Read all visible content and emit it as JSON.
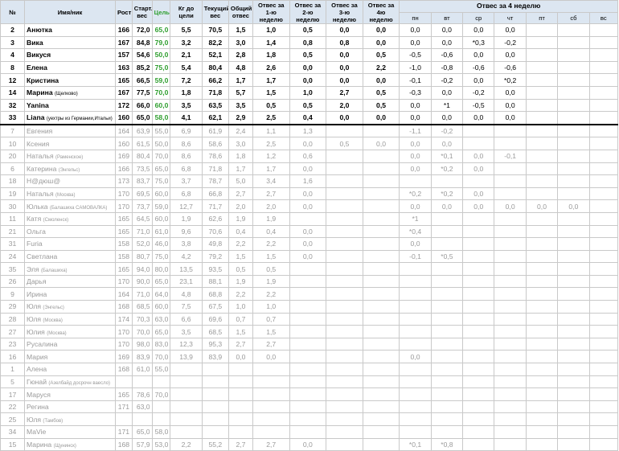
{
  "headers": {
    "num": "№",
    "name": "Имя/ник",
    "height": "Рост",
    "start_weight": "Старт. вес",
    "target": "Цель",
    "to_target": "Кг до цели",
    "current_weight": "Текущий вес",
    "total_loss": "Общий отвес",
    "week1": "Отвес за 1-ю неделю",
    "week2": "Отвес за 2-ю неделю",
    "week3": "Отвес за 3-ю неделю",
    "week4": "Отвес за 4ю неделю",
    "week4_days": "Отвес за 4 неделю",
    "days": [
      "пн",
      "вт",
      "ср",
      "чт",
      "пт",
      "сб",
      "вс"
    ]
  },
  "active_rows": [
    {
      "num": "2",
      "name": "Анютка",
      "note": "",
      "height": "166",
      "start": "72,0",
      "target": "65,0",
      "left": "5,5",
      "current": "70,5",
      "total": "1,5",
      "w1": "1,0",
      "w2": "0,5",
      "w3": "0,0",
      "w4": "0,0",
      "d": [
        "0,0",
        "0,0",
        "0,0",
        "0,0",
        "",
        "",
        ""
      ]
    },
    {
      "num": "3",
      "name": "Вика",
      "note": "",
      "height": "167",
      "start": "84,8",
      "target": "79,0",
      "left": "3,2",
      "current": "82,2",
      "total": "3,0",
      "w1": "1,4",
      "w2": "0,8",
      "w3": "0,8",
      "w4": "0,0",
      "d": [
        "0,0",
        "0,0",
        "*0,3",
        "-0,2",
        "",
        "",
        ""
      ]
    },
    {
      "num": "4",
      "name": "Викуся",
      "note": "",
      "height": "157",
      "start": "54,6",
      "target": "50,0",
      "left": "2,1",
      "current": "52,1",
      "total": "2,8",
      "w1": "1,8",
      "w2": "0,5",
      "w3": "0,0",
      "w4": "0,5",
      "d": [
        "-0,5",
        "-0,6",
        "0,0",
        "0,0",
        "",
        "",
        ""
      ]
    },
    {
      "num": "8",
      "name": "Елена",
      "note": "",
      "height": "163",
      "start": "85,2",
      "target": "75,0",
      "left": "5,4",
      "current": "80,4",
      "total": "4,8",
      "w1": "2,6",
      "w2": "0,0",
      "w3": "0,0",
      "w4": "2,2",
      "d": [
        "-1,0",
        "-0,8",
        "-0,6",
        "-0,6",
        "",
        "",
        ""
      ]
    },
    {
      "num": "12",
      "name": "Кристина",
      "note": "",
      "height": "165",
      "start": "66,5",
      "target": "59,0",
      "left": "7,2",
      "current": "66,2",
      "total": "1,7",
      "w1": "1,7",
      "w2": "0,0",
      "w3": "0,0",
      "w4": "0,0",
      "d": [
        "-0,1",
        "-0,2",
        "0,0",
        "*0,2",
        "",
        "",
        ""
      ]
    },
    {
      "num": "14",
      "name": "Марина",
      "note": "(Щелково)",
      "height": "167",
      "start": "77,5",
      "target": "70,0",
      "left": "1,8",
      "current": "71,8",
      "total": "5,7",
      "w1": "1,5",
      "w2": "1,0",
      "w3": "2,7",
      "w4": "0,5",
      "d": [
        "-0,3",
        "0,0",
        "-0,2",
        "0,0",
        "",
        "",
        ""
      ]
    },
    {
      "num": "32",
      "name": "Yanina",
      "note": "",
      "height": "172",
      "start": "66,0",
      "target": "60,0",
      "left": "3,5",
      "current": "63,5",
      "total": "3,5",
      "w1": "0,5",
      "w2": "0,5",
      "w3": "2,0",
      "w4": "0,5",
      "d": [
        "0,0",
        "*1",
        "-0,5",
        "0,0",
        "",
        "",
        ""
      ]
    },
    {
      "num": "33",
      "name": "Liana",
      "note": "(уехтры из Германии,Итальи)",
      "height": "160",
      "start": "65,0",
      "target": "58,0",
      "left": "4,1",
      "current": "62,1",
      "total": "2,9",
      "w1": "2,5",
      "w2": "0,4",
      "w3": "0,0",
      "w4": "0,0",
      "d": [
        "0,0",
        "0,0",
        "0,0",
        "0,0",
        "",
        "",
        ""
      ]
    }
  ],
  "inactive_rows": [
    {
      "num": "7",
      "name": "Евгения",
      "note": "",
      "height": "164",
      "start": "63,9",
      "target": "55,0",
      "left": "6,9",
      "current": "61,9",
      "total": "2,4",
      "w1": "1,1",
      "w2": "1,3",
      "w3": "",
      "w4": "",
      "d": [
        "-1,1",
        "-0,2",
        "",
        "",
        "",
        "",
        ""
      ]
    },
    {
      "num": "10",
      "name": "Ксения",
      "note": "",
      "height": "160",
      "start": "61,5",
      "target": "50,0",
      "left": "8,6",
      "current": "58,6",
      "total": "3,0",
      "w1": "2,5",
      "w2": "0,0",
      "w3": "0,5",
      "w4": "0,0",
      "d": [
        "0,0",
        "0,0",
        "",
        "",
        "",
        "",
        ""
      ]
    },
    {
      "num": "20",
      "name": "Наталья",
      "note": "(Раменское)",
      "height": "169",
      "start": "80,4",
      "target": "70,0",
      "left": "8,6",
      "current": "78,6",
      "total": "1,8",
      "w1": "1,2",
      "w2": "0,6",
      "w3": "",
      "w4": "",
      "d": [
        "0,0",
        "*0,1",
        "0,0",
        "-0,1",
        "",
        "",
        ""
      ]
    },
    {
      "num": "6",
      "name": "Катерина",
      "note": "(Энгельс)",
      "height": "166",
      "start": "73,5",
      "target": "65,0",
      "left": "6,8",
      "current": "71,8",
      "total": "1,7",
      "w1": "1,7",
      "w2": "0,0",
      "w3": "",
      "w4": "",
      "d": [
        "0,0",
        "*0,2",
        "0,0",
        "",
        "",
        "",
        ""
      ]
    },
    {
      "num": "18",
      "name": "Н@дюш@",
      "note": "",
      "height": "173",
      "start": "83,7",
      "target": "75,0",
      "left": "3,7",
      "current": "78,7",
      "total": "5,0",
      "w1": "3,4",
      "w2": "1,6",
      "w3": "",
      "w4": "",
      "d": [
        "",
        "",
        "",
        "",
        "",
        "",
        ""
      ]
    },
    {
      "num": "19",
      "name": "Наталья",
      "note": "(Москва)",
      "height": "170",
      "start": "69,5",
      "target": "60,0",
      "left": "6,8",
      "current": "66,8",
      "total": "2,7",
      "w1": "2,7",
      "w2": "0,0",
      "w3": "",
      "w4": "",
      "d": [
        "*0,2",
        "*0,2",
        "0,0",
        "",
        "",
        "",
        ""
      ]
    },
    {
      "num": "30",
      "name": "Юлька",
      "note": "(Балашиха САМОВАЛКА)",
      "height": "170",
      "start": "73,7",
      "target": "59,0",
      "left": "12,7",
      "current": "71,7",
      "total": "2,0",
      "w1": "2,0",
      "w2": "0,0",
      "w3": "",
      "w4": "",
      "d": [
        "0,0",
        "0,0",
        "0,0",
        "0,0",
        "0,0",
        "0,0",
        ""
      ]
    },
    {
      "num": "11",
      "name": "Катя",
      "note": "(Смоленск)",
      "height": "165",
      "start": "64,5",
      "target": "60,0",
      "left": "1,9",
      "current": "62,6",
      "total": "1,9",
      "w1": "1,9",
      "w2": "",
      "w3": "",
      "w4": "",
      "d": [
        "*1",
        "",
        "",
        "",
        "",
        "",
        ""
      ]
    },
    {
      "num": "21",
      "name": "Ольга",
      "note": "",
      "height": "165",
      "start": "71,0",
      "target": "61,0",
      "left": "9,6",
      "current": "70,6",
      "total": "0,4",
      "w1": "0,4",
      "w2": "0,0",
      "w3": "",
      "w4": "",
      "d": [
        "*0,4",
        "",
        "",
        "",
        "",
        "",
        ""
      ]
    },
    {
      "num": "31",
      "name": "Furia",
      "note": "",
      "height": "158",
      "start": "52,0",
      "target": "46,0",
      "left": "3,8",
      "current": "49,8",
      "total": "2,2",
      "w1": "2,2",
      "w2": "0,0",
      "w3": "",
      "w4": "",
      "d": [
        "0,0",
        "",
        "",
        "",
        "",
        "",
        ""
      ]
    },
    {
      "num": "24",
      "name": "Светлана",
      "note": "",
      "height": "158",
      "start": "80,7",
      "target": "75,0",
      "left": "4,2",
      "current": "79,2",
      "total": "1,5",
      "w1": "1,5",
      "w2": "0,0",
      "w3": "",
      "w4": "",
      "d": [
        "-0,1",
        "*0,5",
        "",
        "",
        "",
        "",
        ""
      ]
    },
    {
      "num": "35",
      "name": "Эля",
      "note": "(Балашиха)",
      "height": "165",
      "start": "94,0",
      "target": "80,0",
      "left": "13,5",
      "current": "93,5",
      "total": "0,5",
      "w1": "0,5",
      "w2": "",
      "w3": "",
      "w4": "",
      "d": [
        "",
        "",
        "",
        "",
        "",
        "",
        ""
      ]
    },
    {
      "num": "26",
      "name": "Дарья",
      "note": "",
      "height": "170",
      "start": "90,0",
      "target": "65,0",
      "left": "23,1",
      "current": "88,1",
      "total": "1,9",
      "w1": "1,9",
      "w2": "",
      "w3": "",
      "w4": "",
      "d": [
        "",
        "",
        "",
        "",
        "",
        "",
        ""
      ]
    },
    {
      "num": "9",
      "name": "Ирина",
      "note": "",
      "height": "164",
      "start": "71,0",
      "target": "64,0",
      "left": "4,8",
      "current": "68,8",
      "total": "2,2",
      "w1": "2,2",
      "w2": "",
      "w3": "",
      "w4": "",
      "d": [
        "",
        "",
        "",
        "",
        "",
        "",
        ""
      ]
    },
    {
      "num": "29",
      "name": "Юля",
      "note": "(Энгельс)",
      "height": "168",
      "start": "68,5",
      "target": "60,0",
      "left": "7,5",
      "current": "67,5",
      "total": "1,0",
      "w1": "1,0",
      "w2": "",
      "w3": "",
      "w4": "",
      "d": [
        "",
        "",
        "",
        "",
        "",
        "",
        ""
      ]
    },
    {
      "num": "28",
      "name": "Юля",
      "note": "(Москва)",
      "height": "174",
      "start": "70,3",
      "target": "63,0",
      "left": "6,6",
      "current": "69,6",
      "total": "0,7",
      "w1": "0,7",
      "w2": "",
      "w3": "",
      "w4": "",
      "d": [
        "",
        "",
        "",
        "",
        "",
        "",
        ""
      ]
    },
    {
      "num": "27",
      "name": "Юлия",
      "note": "(Москва)",
      "height": "170",
      "start": "70,0",
      "target": "65,0",
      "left": "3,5",
      "current": "68,5",
      "total": "1,5",
      "w1": "1,5",
      "w2": "",
      "w3": "",
      "w4": "",
      "d": [
        "",
        "",
        "",
        "",
        "",
        "",
        ""
      ]
    },
    {
      "num": "23",
      "name": "Русалина",
      "note": "",
      "height": "170",
      "start": "98,0",
      "target": "83,0",
      "left": "12,3",
      "current": "95,3",
      "total": "2,7",
      "w1": "2,7",
      "w2": "",
      "w3": "",
      "w4": "",
      "d": [
        "",
        "",
        "",
        "",
        "",
        "",
        ""
      ]
    },
    {
      "num": "16",
      "name": "Мария",
      "note": "",
      "height": "169",
      "start": "83,9",
      "target": "70,0",
      "left": "13,9",
      "current": "83,9",
      "total": "0,0",
      "w1": "0,0",
      "w2": "",
      "w3": "",
      "w4": "",
      "d": [
        "0,0",
        "",
        "",
        "",
        "",
        "",
        ""
      ]
    },
    {
      "num": "1",
      "name": "Алена",
      "note": "",
      "height": "168",
      "start": "61,0",
      "target": "55,0",
      "left": "",
      "current": "",
      "total": "",
      "w1": "",
      "w2": "",
      "w3": "",
      "w4": "",
      "d": [
        "",
        "",
        "",
        "",
        "",
        "",
        ""
      ]
    },
    {
      "num": "5",
      "name": "Гюнай",
      "note": "(Азелбайд досрочн ваесло)",
      "height": "",
      "start": "",
      "target": "",
      "left": "",
      "current": "",
      "total": "",
      "w1": "",
      "w2": "",
      "w3": "",
      "w4": "",
      "d": [
        "",
        "",
        "",
        "",
        "",
        "",
        ""
      ]
    },
    {
      "num": "17",
      "name": "Маруся",
      "note": "",
      "height": "165",
      "start": "78,6",
      "target": "70,0",
      "left": "",
      "current": "",
      "total": "",
      "w1": "",
      "w2": "",
      "w3": "",
      "w4": "",
      "d": [
        "",
        "",
        "",
        "",
        "",
        "",
        ""
      ]
    },
    {
      "num": "22",
      "name": "Регина",
      "note": "",
      "height": "171",
      "start": "63,0",
      "target": "",
      "left": "",
      "current": "",
      "total": "",
      "w1": "",
      "w2": "",
      "w3": "",
      "w4": "",
      "d": [
        "",
        "",
        "",
        "",
        "",
        "",
        ""
      ]
    },
    {
      "num": "25",
      "name": "Юля",
      "note": "(Тамбов)",
      "height": "",
      "start": "",
      "target": "",
      "left": "",
      "current": "",
      "total": "",
      "w1": "",
      "w2": "",
      "w3": "",
      "w4": "",
      "d": [
        "",
        "",
        "",
        "",
        "",
        "",
        ""
      ]
    },
    {
      "num": "34",
      "name": "MaVie",
      "note": "",
      "height": "171",
      "start": "65,0",
      "target": "58,0",
      "left": "",
      "current": "",
      "total": "",
      "w1": "",
      "w2": "",
      "w3": "",
      "w4": "",
      "d": [
        "",
        "",
        "",
        "",
        "",
        "",
        ""
      ]
    },
    {
      "num": "15",
      "name": "Марина",
      "note": "(Щунинск)",
      "height": "168",
      "start": "57,9",
      "target": "53,0",
      "left": "2,2",
      "current": "55,2",
      "total": "2,7",
      "w1": "2,7",
      "w2": "0,0",
      "w3": "",
      "w4": "",
      "d": [
        "*0,1",
        "*0,8",
        "",
        "",
        "",
        "",
        ""
      ]
    }
  ],
  "colors": {
    "header_bg": "#dce6f1",
    "target": "#2e9e2e",
    "left": "#e02020",
    "inactive_text": "#9a9a9a"
  }
}
